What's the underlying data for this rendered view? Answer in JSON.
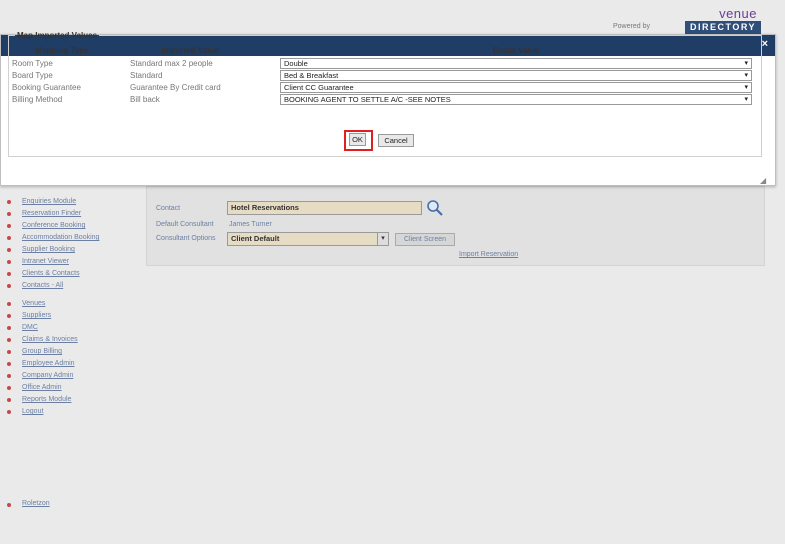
{
  "brand": {
    "powered_by": "Powered by",
    "venue": "venue",
    "directory": "DIRECTORY"
  },
  "dialog": {
    "close": "×",
    "legend": "Map Imported Values",
    "headers": {
      "type": "Mapping Type",
      "imported": "Imported Value",
      "gratis": "Gratis Value"
    },
    "rows": [
      {
        "type": "Room Type",
        "imported": "Standard max 2 people",
        "gratis": "Double"
      },
      {
        "type": "Board Type",
        "imported": "Standard",
        "gratis": "Bed & Breakfast"
      },
      {
        "type": "Booking Guarantee",
        "imported": "Guarantee By Credit card",
        "gratis": "Client CC Guarantee"
      },
      {
        "type": "Billing Method",
        "imported": "Bill back",
        "gratis": "BOOKING AGENT TO SETTLE A/C -SEE NOTES"
      }
    ],
    "ok": "OK",
    "cancel": "Cancel"
  },
  "panel": {
    "contact_label": "Contact",
    "contact_value": "Hotel Reservations",
    "default_consultant_label": "Default Consultant",
    "default_consultant_value": "James Turner",
    "consultant_options_label": "Consultant Options",
    "consultant_options_value": "Client Default",
    "client_screen_button": "Client Screen",
    "import_link": "Import Reservation"
  },
  "menu": {
    "items": [
      "Enquiries Module",
      "Reservation Finder",
      "Conference Booking",
      "Accommodation Booking",
      "Supplier Booking",
      "Intranet Viewer",
      "Clients & Contacts",
      "Contacts - All",
      "Venues",
      "Suppliers",
      "DMC",
      "Claims & Invoices",
      "Group Billing",
      "Employee Admin",
      "Company Admin",
      "Office Admin",
      "Reports Module",
      "Logout"
    ],
    "bottom": "Roletzon"
  }
}
